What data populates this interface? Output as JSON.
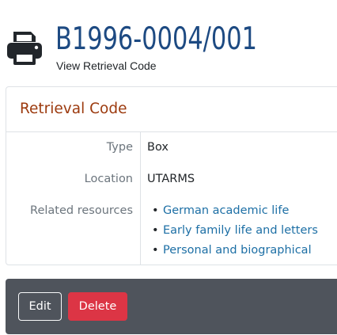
{
  "header": {
    "title": "B1996-0004/001",
    "subtitle_link": "View Retrieval Code",
    "icon": "printer-icon"
  },
  "card": {
    "title": "Retrieval Code",
    "rows": [
      {
        "label": "Type",
        "value": "Box"
      },
      {
        "label": "Location",
        "value": "UTARMS"
      }
    ],
    "related_label": "Related resources",
    "related_items": [
      "German academic life",
      "Early family life and letters",
      "Personal and biographical"
    ]
  },
  "actions": {
    "edit_label": "Edit",
    "delete_label": "Delete"
  },
  "colors": {
    "title": "#1d4a82",
    "card_title": "#9c3a0e",
    "link": "#1d6fa5",
    "toolbar": "#4f545c",
    "danger": "#dc3545"
  }
}
